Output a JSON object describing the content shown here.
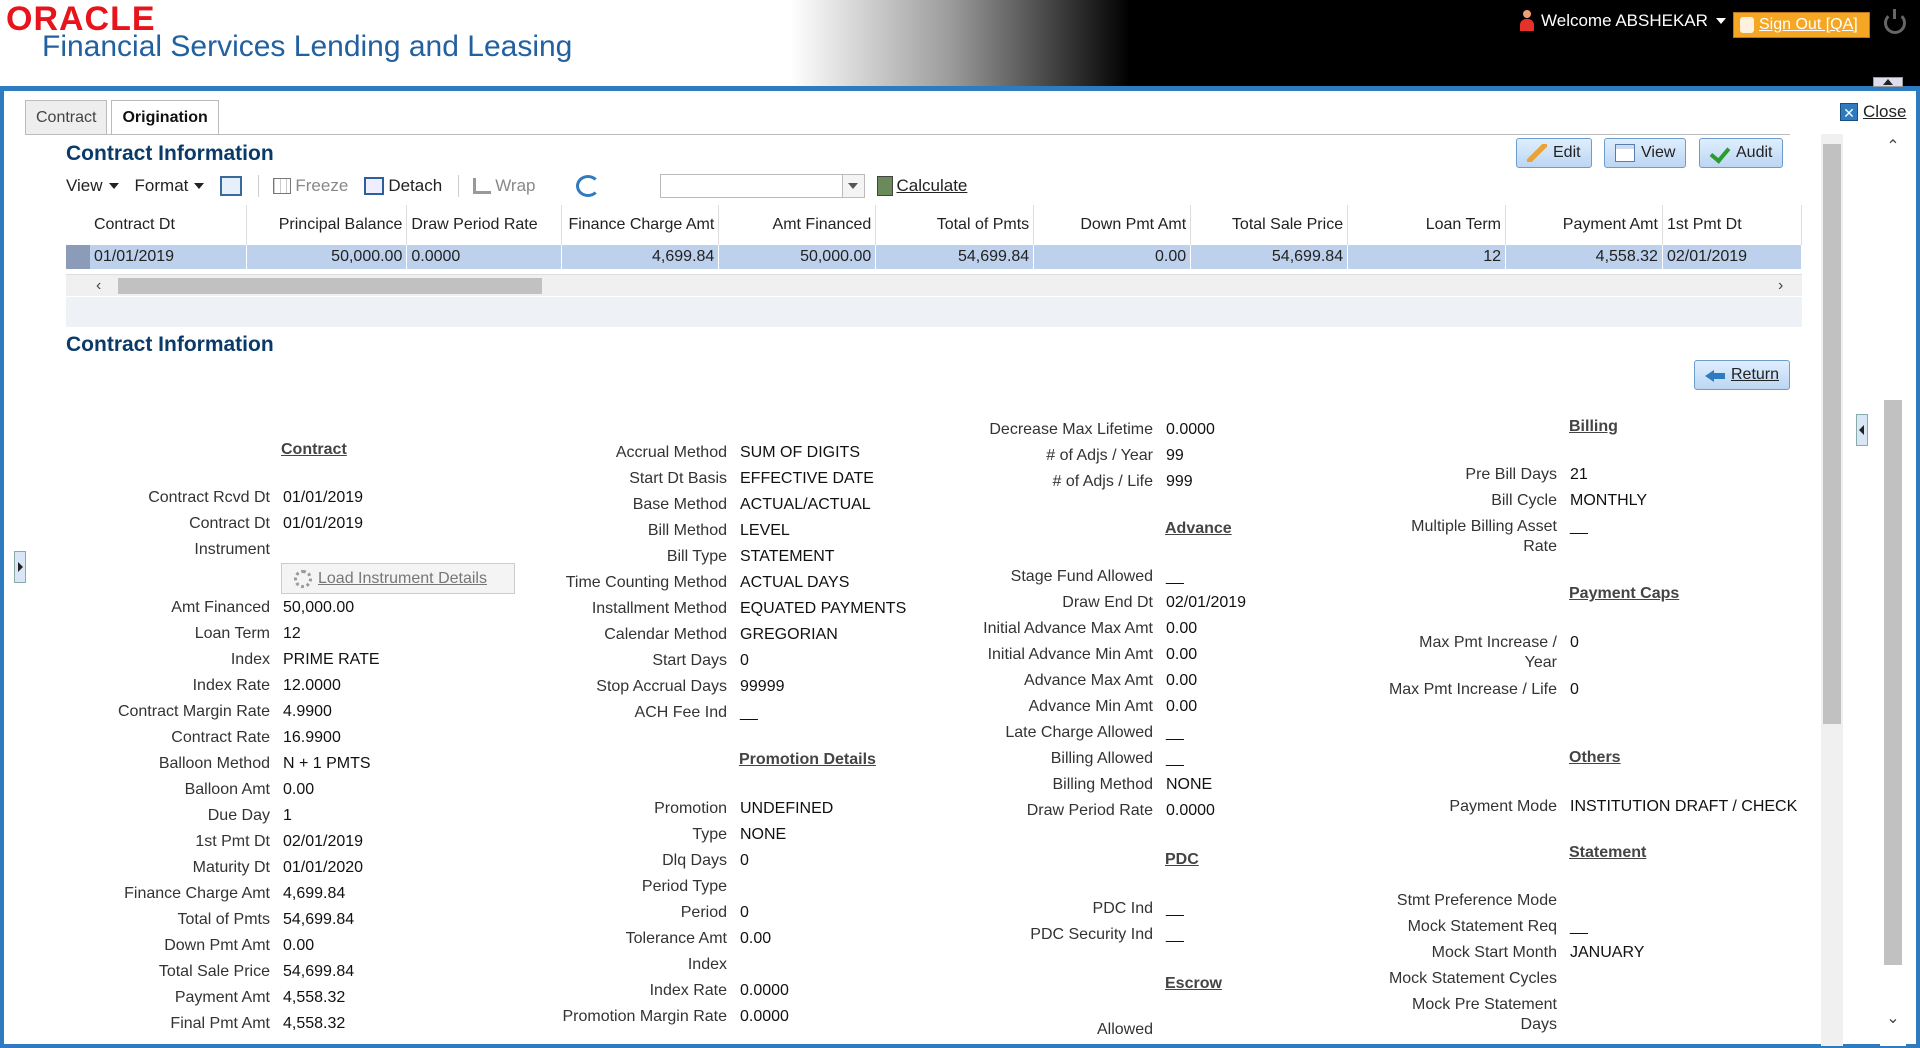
{
  "header": {
    "brand": "ORACLE",
    "product": "Financial Services Lending and Leasing",
    "welcome": "Welcome ABSHEKAR",
    "signout": "Sign Out [QA]"
  },
  "tabs": [
    "Contract",
    "Origination"
  ],
  "close_label": "Close",
  "section1_title": "Contract Information",
  "section2_title": "Contract Information",
  "actions": {
    "edit": "Edit",
    "view": "View",
    "audit": "Audit",
    "return": "Return"
  },
  "toolbar": {
    "view": "View",
    "format": "Format",
    "freeze": "Freeze",
    "detach": "Detach",
    "wrap": "Wrap",
    "calculate": "Calculate"
  },
  "table": {
    "headers": [
      "Contract Dt",
      "Principal Balance",
      "Draw Period Rate",
      "Finance Charge Amt",
      "Amt Financed",
      "Total of Pmts",
      "Down Pmt Amt",
      "Total Sale Price",
      "Loan Term",
      "Payment Amt",
      "1st Pmt Dt"
    ],
    "row": [
      "01/01/2019",
      "50,000.00",
      "0.0000",
      "4,699.84",
      "50,000.00",
      "54,699.84",
      "0.00",
      "54,699.84",
      "12",
      "4,558.32",
      "02/01/2019"
    ]
  },
  "load_instrument": "Load Instrument Details",
  "col1": {
    "group": "Contract",
    "fields": [
      {
        "l": "Contract Rcvd Dt",
        "v": "01/01/2019"
      },
      {
        "l": "Contract Dt",
        "v": "01/01/2019"
      },
      {
        "l": "Instrument",
        "v": ""
      },
      {
        "l": "Amt Financed",
        "v": "50,000.00"
      },
      {
        "l": "Loan Term",
        "v": "12"
      },
      {
        "l": "Index",
        "v": "PRIME RATE"
      },
      {
        "l": "Index Rate",
        "v": "12.0000"
      },
      {
        "l": "Contract Margin Rate",
        "v": "4.9900"
      },
      {
        "l": "Contract Rate",
        "v": "16.9900"
      },
      {
        "l": "Balloon Method",
        "v": "N + 1 PMTS"
      },
      {
        "l": "Balloon Amt",
        "v": "0.00"
      },
      {
        "l": "Due Day",
        "v": "1"
      },
      {
        "l": "1st Pmt Dt",
        "v": "02/01/2019"
      },
      {
        "l": "Maturity Dt",
        "v": "01/01/2020"
      },
      {
        "l": "Finance Charge Amt",
        "v": "4,699.84"
      },
      {
        "l": "Total of Pmts",
        "v": "54,699.84"
      },
      {
        "l": "Down Pmt Amt",
        "v": "0.00"
      },
      {
        "l": "Total Sale Price",
        "v": "54,699.84"
      },
      {
        "l": "Payment Amt",
        "v": "4,558.32"
      },
      {
        "l": "Final Pmt Amt",
        "v": "4,558.32"
      }
    ]
  },
  "col2": {
    "fields": [
      {
        "l": "Accrual Method",
        "v": "SUM OF DIGITS"
      },
      {
        "l": "Start Dt Basis",
        "v": "EFFECTIVE DATE"
      },
      {
        "l": "Base Method",
        "v": "ACTUAL/ACTUAL"
      },
      {
        "l": "Bill Method",
        "v": "LEVEL"
      },
      {
        "l": "Bill Type",
        "v": "STATEMENT"
      },
      {
        "l": "Time Counting Method",
        "v": "ACTUAL DAYS"
      },
      {
        "l": "Installment Method",
        "v": "EQUATED PAYMENTS"
      },
      {
        "l": "Calendar Method",
        "v": "GREGORIAN"
      },
      {
        "l": "Start Days",
        "v": "0"
      },
      {
        "l": "Stop Accrual Days",
        "v": "99999"
      },
      {
        "l": "ACH Fee Ind",
        "v": "__"
      }
    ],
    "group": "Promotion Details",
    "promo": [
      {
        "l": "Promotion",
        "v": "UNDEFINED"
      },
      {
        "l": "Type",
        "v": "NONE"
      },
      {
        "l": "Dlq Days",
        "v": "0"
      },
      {
        "l": "Period Type",
        "v": ""
      },
      {
        "l": "Period",
        "v": "0"
      },
      {
        "l": "Tolerance Amt",
        "v": "0.00"
      },
      {
        "l": "Index",
        "v": ""
      },
      {
        "l": "Index Rate",
        "v": "0.0000"
      },
      {
        "l": "Promotion Margin Rate",
        "v": "0.0000"
      }
    ]
  },
  "col3": {
    "top": [
      {
        "l": "Decrease Max Lifetime",
        "v": "0.0000"
      },
      {
        "l": "# of Adjs / Year",
        "v": "99"
      },
      {
        "l": "# of Adjs / Life",
        "v": "999"
      }
    ],
    "advance_group": "Advance",
    "advance": [
      {
        "l": "Stage Fund Allowed",
        "v": "__"
      },
      {
        "l": "Draw End Dt",
        "v": "02/01/2019"
      },
      {
        "l": "Initial Advance Max Amt",
        "v": "0.00"
      },
      {
        "l": "Initial Advance Min Amt",
        "v": "0.00"
      },
      {
        "l": "Advance Max Amt",
        "v": "0.00"
      },
      {
        "l": "Advance Min Amt",
        "v": "0.00"
      },
      {
        "l": "Late Charge Allowed",
        "v": "__"
      },
      {
        "l": "Billing Allowed",
        "v": "__"
      },
      {
        "l": "Billing Method",
        "v": "NONE"
      },
      {
        "l": "Draw Period Rate",
        "v": "0.0000"
      }
    ],
    "pdc_group": "PDC",
    "pdc": [
      {
        "l": "PDC Ind",
        "v": "__"
      },
      {
        "l": "PDC Security Ind",
        "v": "__"
      }
    ],
    "escrow_group": "Escrow",
    "escrow": [
      {
        "l": "Allowed",
        "v": ""
      }
    ]
  },
  "col4": {
    "billing_group": "Billing",
    "billing": [
      {
        "l": "Pre Bill Days",
        "v": "21"
      },
      {
        "l": "Bill Cycle",
        "v": "MONTHLY"
      },
      {
        "l": "Multiple Billing Asset",
        "l2": "Rate",
        "v": "__"
      }
    ],
    "caps_group": "Payment Caps",
    "caps": [
      {
        "l": "Max Pmt Increase /",
        "l2": "Year",
        "v": "0"
      },
      {
        "l": "Max Pmt Increase / Life",
        "v": "0"
      }
    ],
    "others_group": "Others",
    "others": [
      {
        "l": "Payment Mode",
        "v": "INSTITUTION DRAFT / CHECK"
      }
    ],
    "stmt_group": "Statement",
    "stmt": [
      {
        "l": "Stmt Preference Mode",
        "v": ""
      },
      {
        "l": "Mock Statement Req",
        "v": "__"
      },
      {
        "l": "Mock Start Month",
        "v": "JANUARY"
      },
      {
        "l": "Mock Statement Cycles",
        "v": ""
      },
      {
        "l": "Mock Pre Statement",
        "l2": "Days",
        "v": ""
      }
    ]
  }
}
